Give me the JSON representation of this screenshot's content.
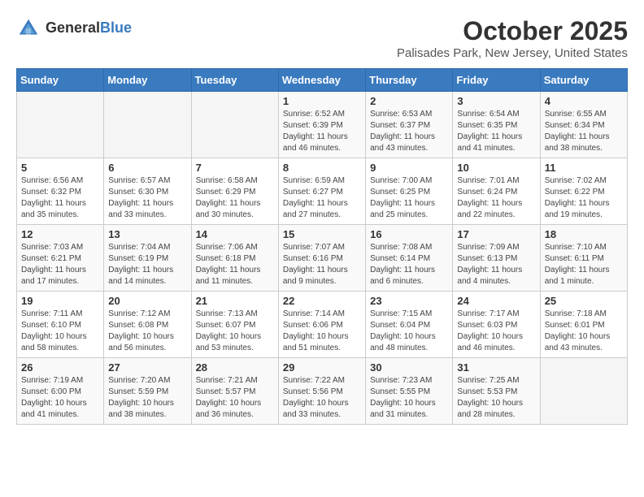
{
  "header": {
    "logo_general": "General",
    "logo_blue": "Blue",
    "month_title": "October 2025",
    "location": "Palisades Park, New Jersey, United States"
  },
  "weekdays": [
    "Sunday",
    "Monday",
    "Tuesday",
    "Wednesday",
    "Thursday",
    "Friday",
    "Saturday"
  ],
  "weeks": [
    [
      {
        "day": "",
        "info": ""
      },
      {
        "day": "",
        "info": ""
      },
      {
        "day": "",
        "info": ""
      },
      {
        "day": "1",
        "info": "Sunrise: 6:52 AM\nSunset: 6:39 PM\nDaylight: 11 hours\nand 46 minutes."
      },
      {
        "day": "2",
        "info": "Sunrise: 6:53 AM\nSunset: 6:37 PM\nDaylight: 11 hours\nand 43 minutes."
      },
      {
        "day": "3",
        "info": "Sunrise: 6:54 AM\nSunset: 6:35 PM\nDaylight: 11 hours\nand 41 minutes."
      },
      {
        "day": "4",
        "info": "Sunrise: 6:55 AM\nSunset: 6:34 PM\nDaylight: 11 hours\nand 38 minutes."
      }
    ],
    [
      {
        "day": "5",
        "info": "Sunrise: 6:56 AM\nSunset: 6:32 PM\nDaylight: 11 hours\nand 35 minutes."
      },
      {
        "day": "6",
        "info": "Sunrise: 6:57 AM\nSunset: 6:30 PM\nDaylight: 11 hours\nand 33 minutes."
      },
      {
        "day": "7",
        "info": "Sunrise: 6:58 AM\nSunset: 6:29 PM\nDaylight: 11 hours\nand 30 minutes."
      },
      {
        "day": "8",
        "info": "Sunrise: 6:59 AM\nSunset: 6:27 PM\nDaylight: 11 hours\nand 27 minutes."
      },
      {
        "day": "9",
        "info": "Sunrise: 7:00 AM\nSunset: 6:25 PM\nDaylight: 11 hours\nand 25 minutes."
      },
      {
        "day": "10",
        "info": "Sunrise: 7:01 AM\nSunset: 6:24 PM\nDaylight: 11 hours\nand 22 minutes."
      },
      {
        "day": "11",
        "info": "Sunrise: 7:02 AM\nSunset: 6:22 PM\nDaylight: 11 hours\nand 19 minutes."
      }
    ],
    [
      {
        "day": "12",
        "info": "Sunrise: 7:03 AM\nSunset: 6:21 PM\nDaylight: 11 hours\nand 17 minutes."
      },
      {
        "day": "13",
        "info": "Sunrise: 7:04 AM\nSunset: 6:19 PM\nDaylight: 11 hours\nand 14 minutes."
      },
      {
        "day": "14",
        "info": "Sunrise: 7:06 AM\nSunset: 6:18 PM\nDaylight: 11 hours\nand 11 minutes."
      },
      {
        "day": "15",
        "info": "Sunrise: 7:07 AM\nSunset: 6:16 PM\nDaylight: 11 hours\nand 9 minutes."
      },
      {
        "day": "16",
        "info": "Sunrise: 7:08 AM\nSunset: 6:14 PM\nDaylight: 11 hours\nand 6 minutes."
      },
      {
        "day": "17",
        "info": "Sunrise: 7:09 AM\nSunset: 6:13 PM\nDaylight: 11 hours\nand 4 minutes."
      },
      {
        "day": "18",
        "info": "Sunrise: 7:10 AM\nSunset: 6:11 PM\nDaylight: 11 hours\nand 1 minute."
      }
    ],
    [
      {
        "day": "19",
        "info": "Sunrise: 7:11 AM\nSunset: 6:10 PM\nDaylight: 10 hours\nand 58 minutes."
      },
      {
        "day": "20",
        "info": "Sunrise: 7:12 AM\nSunset: 6:08 PM\nDaylight: 10 hours\nand 56 minutes."
      },
      {
        "day": "21",
        "info": "Sunrise: 7:13 AM\nSunset: 6:07 PM\nDaylight: 10 hours\nand 53 minutes."
      },
      {
        "day": "22",
        "info": "Sunrise: 7:14 AM\nSunset: 6:06 PM\nDaylight: 10 hours\nand 51 minutes."
      },
      {
        "day": "23",
        "info": "Sunrise: 7:15 AM\nSunset: 6:04 PM\nDaylight: 10 hours\nand 48 minutes."
      },
      {
        "day": "24",
        "info": "Sunrise: 7:17 AM\nSunset: 6:03 PM\nDaylight: 10 hours\nand 46 minutes."
      },
      {
        "day": "25",
        "info": "Sunrise: 7:18 AM\nSunset: 6:01 PM\nDaylight: 10 hours\nand 43 minutes."
      }
    ],
    [
      {
        "day": "26",
        "info": "Sunrise: 7:19 AM\nSunset: 6:00 PM\nDaylight: 10 hours\nand 41 minutes."
      },
      {
        "day": "27",
        "info": "Sunrise: 7:20 AM\nSunset: 5:59 PM\nDaylight: 10 hours\nand 38 minutes."
      },
      {
        "day": "28",
        "info": "Sunrise: 7:21 AM\nSunset: 5:57 PM\nDaylight: 10 hours\nand 36 minutes."
      },
      {
        "day": "29",
        "info": "Sunrise: 7:22 AM\nSunset: 5:56 PM\nDaylight: 10 hours\nand 33 minutes."
      },
      {
        "day": "30",
        "info": "Sunrise: 7:23 AM\nSunset: 5:55 PM\nDaylight: 10 hours\nand 31 minutes."
      },
      {
        "day": "31",
        "info": "Sunrise: 7:25 AM\nSunset: 5:53 PM\nDaylight: 10 hours\nand 28 minutes."
      },
      {
        "day": "",
        "info": ""
      }
    ]
  ]
}
